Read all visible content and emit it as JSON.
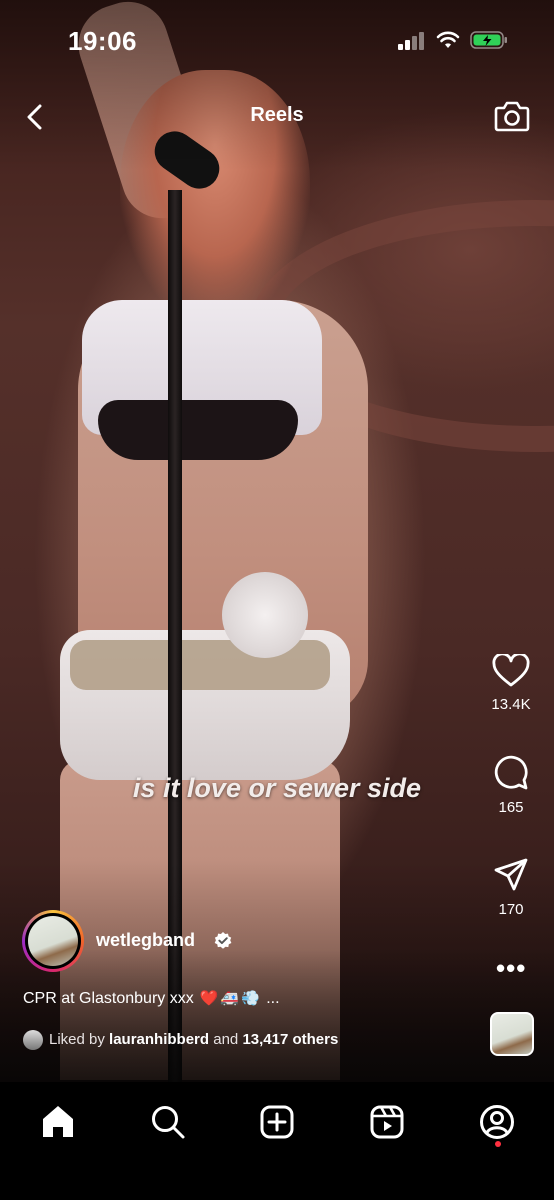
{
  "status_bar": {
    "time": "19:06"
  },
  "header": {
    "back_icon": "chevron-left-icon",
    "title": "Reels",
    "camera_icon": "camera-icon"
  },
  "video": {
    "overlay_text": "is it love or sewer side"
  },
  "actions": {
    "like": {
      "icon": "heart-icon",
      "count": "13.4K"
    },
    "comment": {
      "icon": "comment-icon",
      "count": "165"
    },
    "share": {
      "icon": "send-icon",
      "count": "170"
    },
    "more": {
      "icon": "more-icon",
      "label": "•••"
    }
  },
  "post": {
    "username": "wetlegband",
    "verified": true,
    "caption": "CPR at Glastonbury xxx",
    "caption_emojis": "❤️🚑💨",
    "caption_more": "...",
    "liked_by_prefix": "Liked by",
    "liked_by_user": "lauranhibberd",
    "liked_by_conj": "and",
    "liked_by_others": "13,417 others"
  },
  "bottom_nav": {
    "items": [
      {
        "name": "home",
        "icon": "home-icon",
        "active": true
      },
      {
        "name": "search",
        "icon": "search-icon"
      },
      {
        "name": "create",
        "icon": "plus-square-icon"
      },
      {
        "name": "reels",
        "icon": "reels-icon"
      },
      {
        "name": "profile",
        "icon": "profile-icon",
        "notification": true
      }
    ]
  },
  "colors": {
    "accent_gradient": [
      "#f9c23c",
      "#d9276e",
      "#9b2cc4"
    ],
    "notification": "#ff3040",
    "battery": "#30d158"
  }
}
